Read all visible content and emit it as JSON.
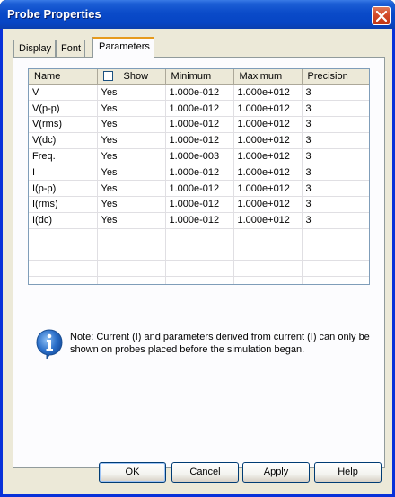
{
  "window": {
    "title": "Probe Properties"
  },
  "tabs": [
    {
      "label": "Display"
    },
    {
      "label": "Font"
    },
    {
      "label": "Parameters"
    }
  ],
  "grid": {
    "columns": [
      "Name",
      "Show",
      "Minimum",
      "Maximum",
      "Precision"
    ],
    "show_header_checked": false,
    "rows": [
      {
        "name": "V",
        "show": "Yes",
        "min": "1.000e-012",
        "max": "1.000e+012",
        "precision": "3"
      },
      {
        "name": "V(p-p)",
        "show": "Yes",
        "min": "1.000e-012",
        "max": "1.000e+012",
        "precision": "3"
      },
      {
        "name": "V(rms)",
        "show": "Yes",
        "min": "1.000e-012",
        "max": "1.000e+012",
        "precision": "3"
      },
      {
        "name": "V(dc)",
        "show": "Yes",
        "min": "1.000e-012",
        "max": "1.000e+012",
        "precision": "3"
      },
      {
        "name": "Freq.",
        "show": "Yes",
        "min": "1.000e-003",
        "max": "1.000e+012",
        "precision": "3"
      },
      {
        "name": "I",
        "show": "Yes",
        "min": "1.000e-012",
        "max": "1.000e+012",
        "precision": "3"
      },
      {
        "name": "I(p-p)",
        "show": "Yes",
        "min": "1.000e-012",
        "max": "1.000e+012",
        "precision": "3"
      },
      {
        "name": "I(rms)",
        "show": "Yes",
        "min": "1.000e-012",
        "max": "1.000e+012",
        "precision": "3"
      },
      {
        "name": "I(dc)",
        "show": "Yes",
        "min": "1.000e-012",
        "max": "1.000e+012",
        "precision": "3"
      }
    ],
    "empty_rows": 4
  },
  "note": {
    "icon": "info-icon",
    "text": "Note: Current (I) and parameters derived from current (I) can only be shown on probes placed before the simulation began."
  },
  "buttons": {
    "ok": "OK",
    "cancel": "Cancel",
    "apply": "Apply",
    "help": "Help"
  },
  "colors": {
    "titlebar": "#0a4bc9",
    "dialog_bg": "#ece9d8",
    "active_tab_accent": "#e69a1d",
    "info_icon": "#2a6ec8"
  }
}
